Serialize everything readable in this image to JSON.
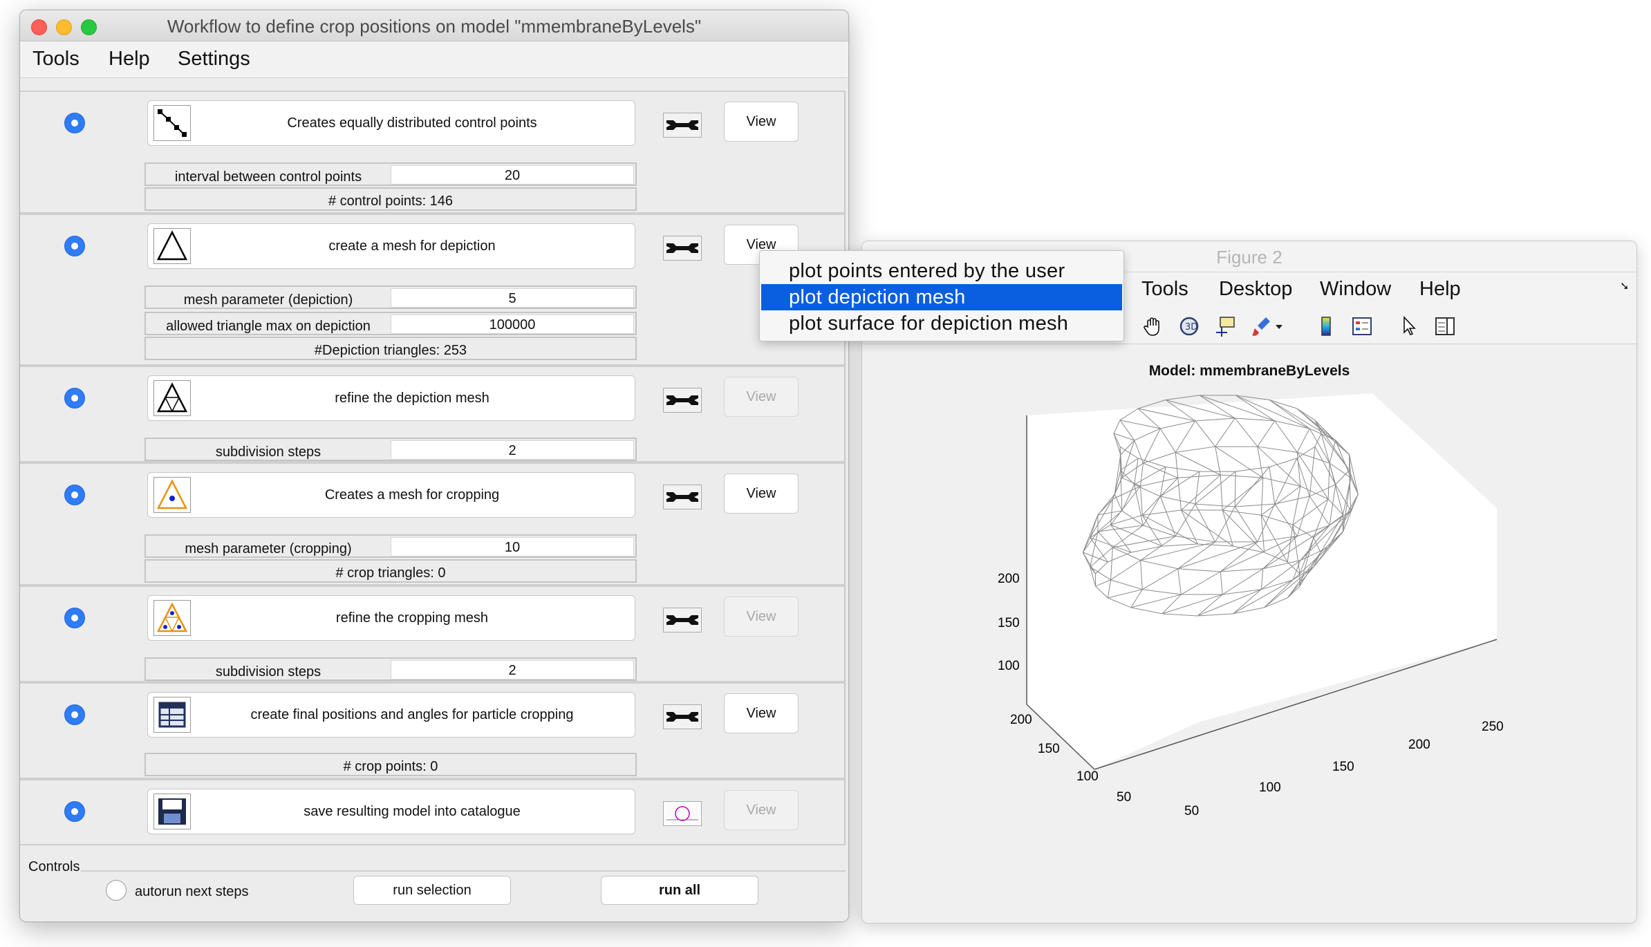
{
  "workflow_window": {
    "title": "Workflow to define crop positions on model \"mmembraneByLevels\"",
    "menu": [
      "Tools",
      "Help",
      "Settings"
    ],
    "steps": [
      {
        "action": "Creates equally distributed control points",
        "view": "View",
        "view_enabled": true,
        "icon": "control-points-icon",
        "params": [
          {
            "label": "interval between control points",
            "value": "20"
          }
        ],
        "info": "# control points: 146"
      },
      {
        "action": "create a mesh  for depiction",
        "view": "View",
        "view_enabled": true,
        "icon": "triangle-mesh-icon",
        "params": [
          {
            "label": "mesh parameter (depiction)",
            "value": "5"
          },
          {
            "label": "allowed triangle max on depiction",
            "value": "100000"
          }
        ],
        "info": "#Depiction triangles: 253"
      },
      {
        "action": "refine the depiction mesh",
        "view": "View",
        "view_enabled": false,
        "icon": "refine-mesh-icon",
        "params": [
          {
            "label": "subdivision steps",
            "value": "2"
          }
        ]
      },
      {
        "action": "Creates a mesh for cropping",
        "view": "View",
        "view_enabled": true,
        "icon": "crop-mesh-icon",
        "params": [
          {
            "label": "mesh parameter (cropping)",
            "value": "10"
          }
        ],
        "info": "# crop triangles: 0"
      },
      {
        "action": "refine the cropping mesh",
        "view": "View",
        "view_enabled": false,
        "icon": "refine-crop-mesh-icon",
        "params": [
          {
            "label": "subdivision steps",
            "value": "2"
          }
        ]
      },
      {
        "action": "create final positions and angles for particle cropping",
        "view": "View",
        "view_enabled": true,
        "icon": "table-icon",
        "params": [],
        "info": "# crop points: 0"
      },
      {
        "action": "save resulting model into catalogue",
        "view": "View",
        "view_enabled": false,
        "icon": "floppy-disk-icon",
        "params": []
      }
    ],
    "controls": {
      "title": "Controls",
      "autorun_label": "autorun next steps",
      "run_selection": "run selection",
      "run_all": "run all"
    }
  },
  "figure_window": {
    "title": "Figure 2",
    "menu": [
      "Tools",
      "Desktop",
      "Window",
      "Help"
    ],
    "plot_title": "Model: mmembraneByLevels"
  },
  "popup_menu": {
    "items": [
      "plot points entered by the user",
      "plot depiction mesh",
      "plot surface for depiction mesh"
    ],
    "selected_index": 1
  },
  "chart_data": {
    "type": "3d-mesh",
    "title": "Model: mmembraneByLevels",
    "z_ticks": [
      "100",
      "150",
      "200"
    ],
    "y_ticks": [
      "50",
      "100",
      "150",
      "200"
    ],
    "x_ticks": [
      "50",
      "100",
      "150",
      "200",
      "250"
    ],
    "mesh_color": "#8a8a8a"
  }
}
